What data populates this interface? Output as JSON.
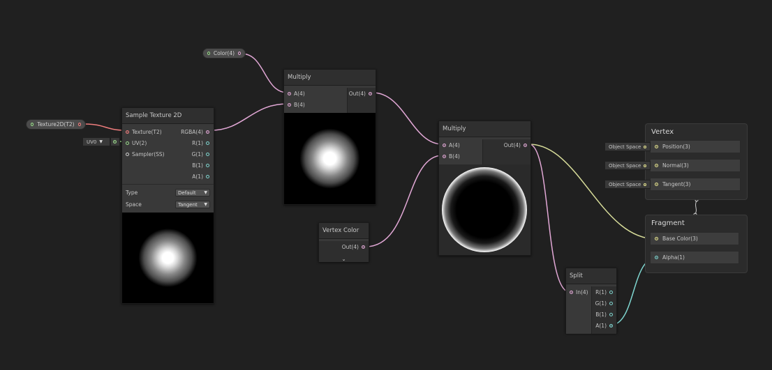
{
  "properties": {
    "color": "Color(4)",
    "texture": "Texture2D(T2)"
  },
  "sample_texture": {
    "title": "Sample Texture 2D",
    "inputs": [
      "Texture(T2)",
      "UV(2)",
      "Sampler(SS)"
    ],
    "outputs": [
      "RGBA(4)",
      "R(1)",
      "G(1)",
      "B(1)",
      "A(1)"
    ],
    "uv_value": "UV0",
    "type_label": "Type",
    "type_value": "Default",
    "space_label": "Space",
    "space_value": "Tangent"
  },
  "multiply1": {
    "title": "Multiply",
    "inputs": [
      "A(4)",
      "B(4)"
    ],
    "output": "Out(4)"
  },
  "multiply2": {
    "title": "Multiply",
    "inputs": [
      "A(4)",
      "B(4)"
    ],
    "output": "Out(4)"
  },
  "vertex_color": {
    "title": "Vertex Color",
    "output": "Out(4)"
  },
  "split": {
    "title": "Split",
    "input": "In(4)",
    "outputs": [
      "R(1)",
      "G(1)",
      "B(1)",
      "A(1)"
    ]
  },
  "vertex_context": {
    "title": "Vertex",
    "blocks": [
      "Position(3)",
      "Normal(3)",
      "Tangent(3)"
    ],
    "space_value": "Object Space"
  },
  "fragment_context": {
    "title": "Fragment",
    "blocks": [
      "Base Color(3)",
      "Alpha(1)"
    ]
  },
  "colors": {
    "background": "#202020",
    "vector4_port": "#e2a8d6",
    "texture_port": "#ef7d7d",
    "vector2_port": "#9bdb8c",
    "float_port": "#7fd6d0",
    "vector3_port": "#e3e18e"
  }
}
